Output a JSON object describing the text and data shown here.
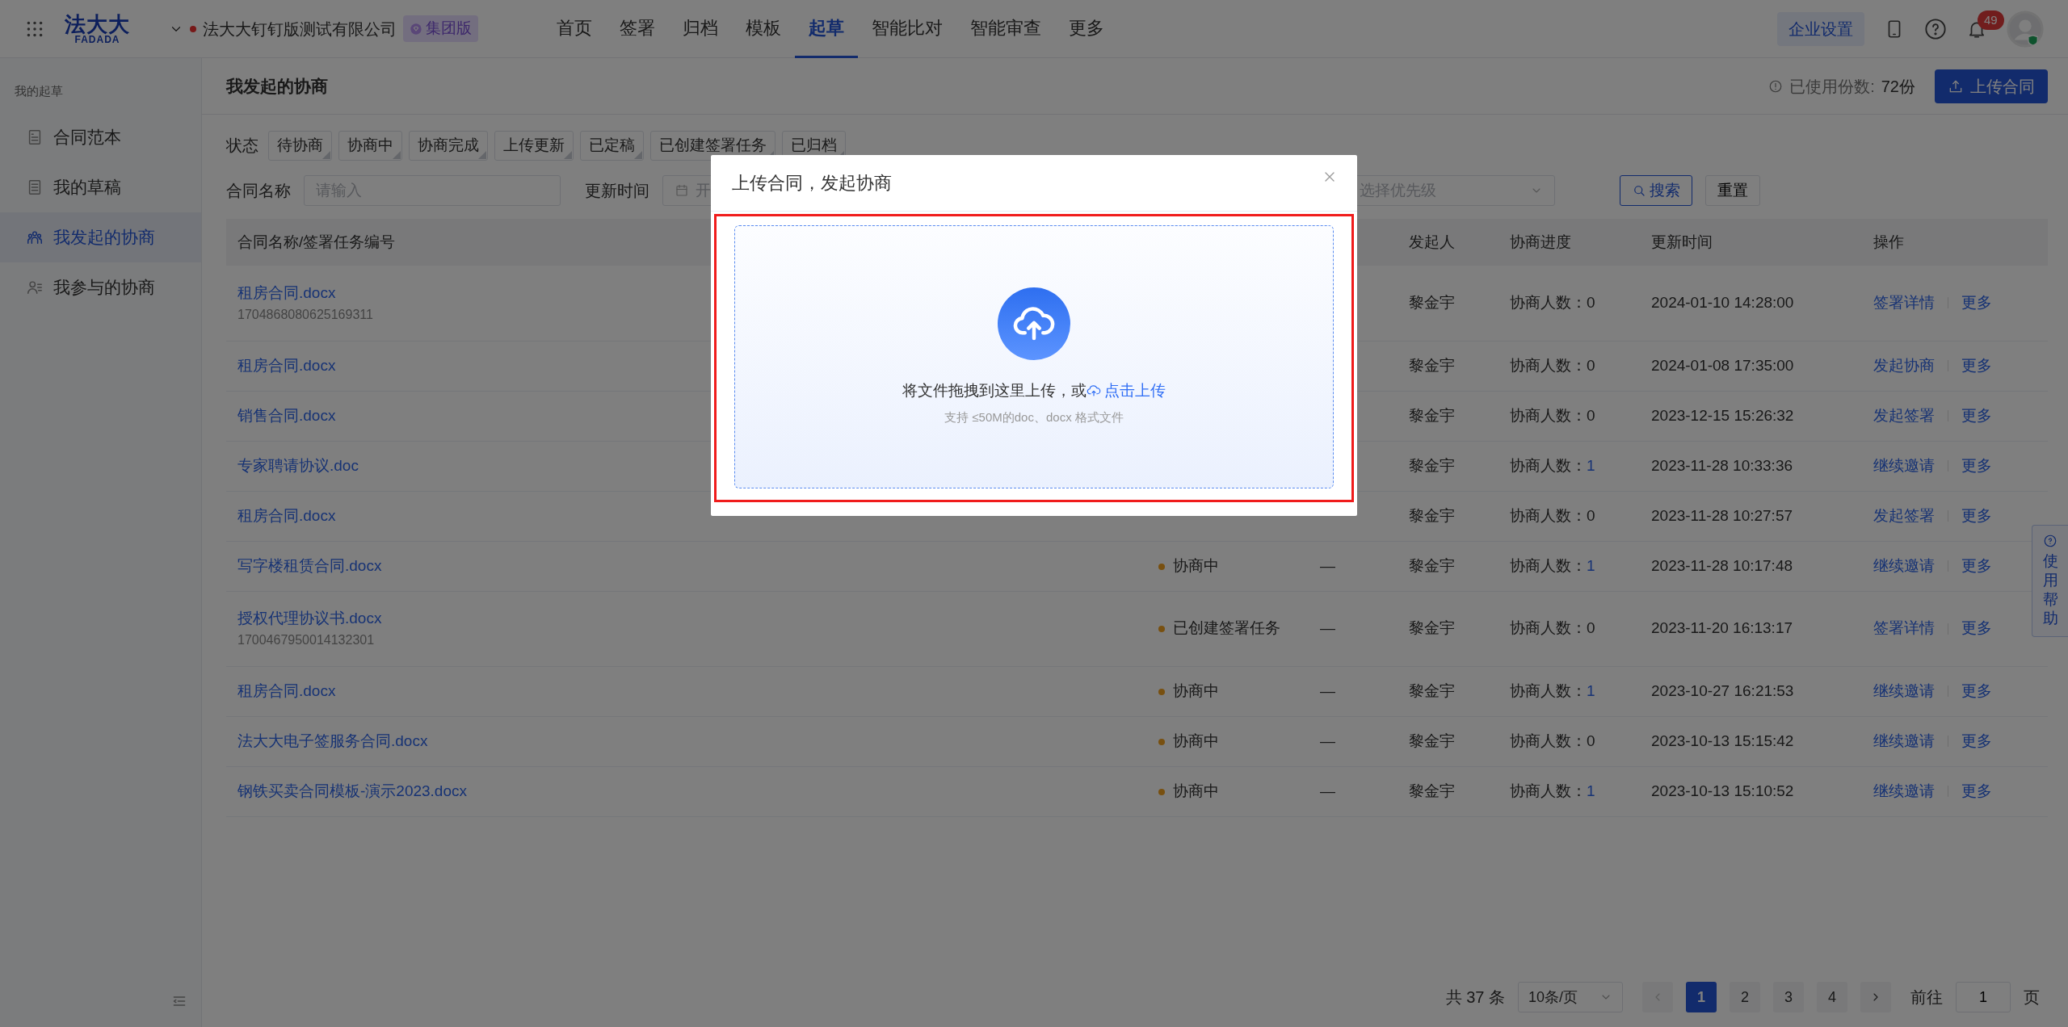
{
  "topbar": {
    "logo": "法大大",
    "logo_subtext": "FADADA",
    "company": "法大大钉钉版测试有限公司",
    "edition": "集团版",
    "nav": [
      {
        "label": "首页",
        "selected": false
      },
      {
        "label": "签署",
        "selected": false
      },
      {
        "label": "归档",
        "selected": false
      },
      {
        "label": "模板",
        "selected": false
      },
      {
        "label": "起草",
        "selected": true
      },
      {
        "label": "智能比对",
        "selected": false
      },
      {
        "label": "智能审查",
        "selected": false
      },
      {
        "label": "更多",
        "selected": false
      }
    ],
    "settings_button": "企业设置",
    "notification_count": "49"
  },
  "sidebar": {
    "heading": "我的起草",
    "items": [
      {
        "label": "合同范本",
        "kind": "template",
        "selected": false
      },
      {
        "label": "我的草稿",
        "kind": "draft",
        "selected": false
      },
      {
        "label": "我发起的协商",
        "kind": "group",
        "selected": true
      },
      {
        "label": "我参与的协商",
        "kind": "member",
        "selected": false
      }
    ]
  },
  "page": {
    "title": "我发起的协商",
    "usage_label": "已使用份数:",
    "usage_value": "72份",
    "upload_button": "上传合同"
  },
  "filters": {
    "status_label": "状态",
    "status_tags": [
      {
        "label": "待协商",
        "selected": false
      },
      {
        "label": "协商中",
        "selected": false
      },
      {
        "label": "协商完成",
        "selected": false
      },
      {
        "label": "上传更新",
        "selected": false
      },
      {
        "label": "已定稿",
        "selected": false
      },
      {
        "label": "已创建签署任务",
        "selected": false
      },
      {
        "label": "已归档",
        "selected": false
      }
    ],
    "name_label": "合同名称",
    "name_placeholder": "请输入",
    "time_label": "更新时间",
    "date_placeholder": "开",
    "priority_placeholder": "选择优先级",
    "search_button": "搜索",
    "reset_button": "重置"
  },
  "table": {
    "columns": {
      "name": "合同名称/签署任务编号",
      "initiator": "发起人",
      "progress": "协商进度",
      "updated": "更新时间",
      "actions": "操作"
    },
    "rows": [
      {
        "name": "租房合同.docx",
        "task_id": "1704868080625169311",
        "initiator": "黎金宇",
        "progress_label": "协商人数：",
        "progress_count": "0",
        "progress_active": false,
        "updated": "2024-01-10 14:28:00",
        "actions": [
          "签署详情",
          "更多"
        ]
      },
      {
        "name": "租房合同.docx",
        "initiator": "黎金宇",
        "progress_label": "协商人数：",
        "progress_count": "0",
        "progress_active": false,
        "updated": "2024-01-08 17:35:00",
        "actions": [
          "发起协商",
          "更多"
        ]
      },
      {
        "name": "销售合同.docx",
        "initiator": "黎金宇",
        "progress_label": "协商人数：",
        "progress_count": "0",
        "progress_active": false,
        "updated": "2023-12-15 15:26:32",
        "actions": [
          "发起签署",
          "更多"
        ]
      },
      {
        "name": "专家聘请协议.doc",
        "initiator": "黎金宇",
        "progress_label": "协商人数：",
        "progress_count": "1",
        "progress_active": true,
        "updated": "2023-11-28 10:33:36",
        "actions": [
          "继续邀请",
          "更多"
        ]
      },
      {
        "name": "租房合同.docx",
        "initiator": "黎金宇",
        "progress_label": "协商人数：",
        "progress_count": "0",
        "progress_active": false,
        "updated": "2023-11-28 10:27:57",
        "actions": [
          "发起签署",
          "更多"
        ]
      },
      {
        "name": "写字楼租赁合同.docx",
        "status": "协商中",
        "column_3": "—",
        "initiator": "黎金宇",
        "progress_label": "协商人数：",
        "progress_count": "1",
        "progress_active": true,
        "updated": "2023-11-28 10:17:48",
        "actions": [
          "继续邀请",
          "更多"
        ]
      },
      {
        "name": "授权代理协议书.docx",
        "task_id": "1700467950014132301",
        "status": "已创建签署任务",
        "column_3": "—",
        "initiator": "黎金宇",
        "progress_label": "协商人数：",
        "progress_count": "0",
        "progress_active": false,
        "updated": "2023-11-20 16:13:17",
        "actions": [
          "签署详情",
          "更多"
        ]
      },
      {
        "name": "租房合同.docx",
        "status": "协商中",
        "column_3": "—",
        "initiator": "黎金宇",
        "progress_label": "协商人数：",
        "progress_count": "1",
        "progress_active": true,
        "updated": "2023-10-27 16:21:53",
        "actions": [
          "继续邀请",
          "更多"
        ]
      },
      {
        "name": "法大大电子签服务合同.docx",
        "status": "协商中",
        "column_3": "—",
        "initiator": "黎金宇",
        "progress_label": "协商人数：",
        "progress_count": "0",
        "progress_active": false,
        "updated": "2023-10-13 15:15:42",
        "actions": [
          "继续邀请",
          "更多"
        ]
      },
      {
        "name": "钢铁买卖合同模板-演示2023.docx",
        "status": "协商中",
        "column_3": "—",
        "initiator": "黎金宇",
        "progress_label": "协商人数：",
        "progress_count": "1",
        "progress_active": true,
        "updated": "2023-10-13 15:10:52",
        "actions": [
          "继续邀请",
          "更多"
        ]
      }
    ]
  },
  "pagination": {
    "total": "共 37 条",
    "page_size": "10条/页",
    "pages": [
      {
        "label": "1",
        "selected": true
      },
      {
        "label": "2",
        "selected": false
      },
      {
        "label": "3",
        "selected": false
      },
      {
        "label": "4",
        "selected": false
      }
    ],
    "goto_label": "前往",
    "goto_value": "1",
    "goto_suffix": "页"
  },
  "help_tab": "使用帮助",
  "modal": {
    "title": "上传合同，发起协商",
    "drop_text": "将文件拖拽到这里上传，或",
    "upload_link": "点击上传",
    "hint": "支持 ≤50M的doc、docx 格式文件"
  }
}
